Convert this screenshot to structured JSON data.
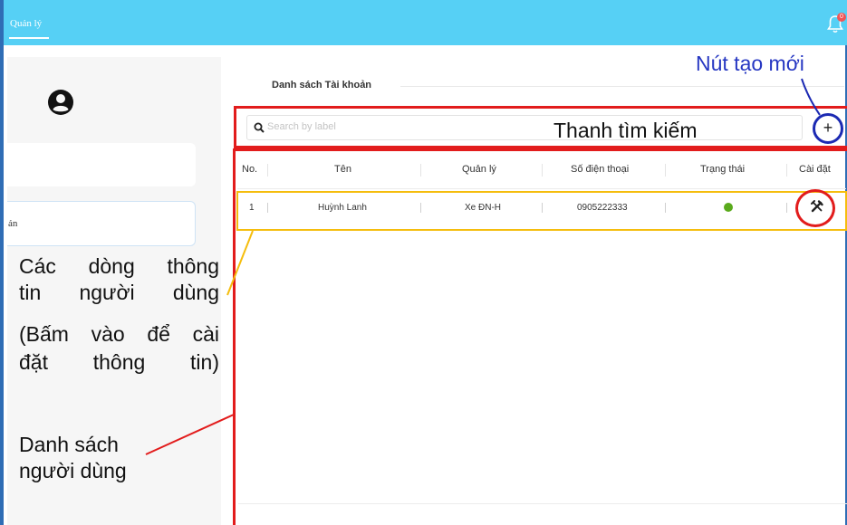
{
  "topbar": {
    "nav_label": "Quản lý",
    "notification_count": "0"
  },
  "sidebar": {
    "item_label": "ản"
  },
  "main": {
    "title": "Danh sách Tài khoản",
    "search_placeholder": "Search by label",
    "add_label": "+"
  },
  "table": {
    "columns": [
      "No.",
      "Tên",
      "Quản lý",
      "Số điện thoại",
      "Trạng thái",
      "Cài đặt"
    ],
    "rows": [
      {
        "no": "1",
        "name": "Huỳnh Lanh",
        "manager": "Xe ĐN-H",
        "phone": "0905222333",
        "status": "active"
      }
    ]
  },
  "annotations": {
    "search": "Thanh tìm kiếm",
    "add_button": "Nút tạo mới",
    "rows_line1": "Các dòng thông",
    "rows_line2": "tin người dùng",
    "rows_hint_line1": "(Bấm vào để cài",
    "rows_hint_line2": "đặt thông tin)",
    "list_line1": "Danh sách",
    "list_line2": "người dùng"
  },
  "colors": {
    "topbar": "#56d0f5",
    "annotation_red": "#e21c1c",
    "annotation_blue": "#1c2ab3",
    "annotation_yellow": "#f5bd0d",
    "status_active": "#5aaa1c"
  }
}
